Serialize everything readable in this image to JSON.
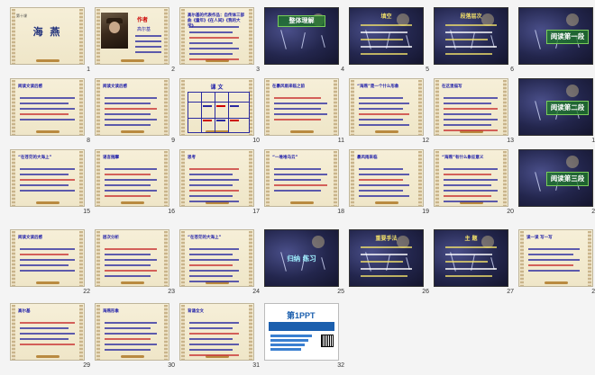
{
  "grid": {
    "rows": [
      [
        {
          "num": "1",
          "kind": "title",
          "label": "第十课",
          "title": "海 燕"
        },
        {
          "num": "2",
          "kind": "author",
          "label": "作者",
          "text": "高尔基"
        },
        {
          "num": "3",
          "kind": "text",
          "text": "高尔基的代表作品：自传体三部曲《童年》《在人间》《我的大学》"
        },
        {
          "num": "4",
          "kind": "dark",
          "title": "整体理解"
        },
        {
          "num": "5",
          "kind": "dark",
          "title": "填空"
        },
        {
          "num": "6",
          "kind": "dark",
          "title": "段落层次"
        },
        {
          "num": "7",
          "kind": "dark",
          "title": "阅读第一段"
        }
      ],
      [
        {
          "num": "8",
          "kind": "text",
          "text": "阅读文读后感"
        },
        {
          "num": "9",
          "kind": "text",
          "text": "阅读文读后感"
        },
        {
          "num": "10",
          "kind": "table",
          "text": "课 文"
        },
        {
          "num": "11",
          "kind": "text",
          "text": "在暴风雨来临之前"
        },
        {
          "num": "12",
          "kind": "text",
          "text": "“海燕”是一个什么形象"
        },
        {
          "num": "13",
          "kind": "text",
          "text": "在这里描写"
        },
        {
          "num": "14",
          "kind": "dark",
          "title": "阅读第二段"
        }
      ],
      [
        {
          "num": "15",
          "kind": "text",
          "text": "“在苍茫的大海上”"
        },
        {
          "num": "16",
          "kind": "text",
          "text": "语言揣摩"
        },
        {
          "num": "17",
          "kind": "text",
          "text": "思考"
        },
        {
          "num": "18",
          "kind": "text",
          "text": "“一堆堆乌云”"
        },
        {
          "num": "19",
          "kind": "text",
          "text": "暴风雨来临"
        },
        {
          "num": "20",
          "kind": "text",
          "text": "“海燕”有什么象征意义"
        },
        {
          "num": "21",
          "kind": "dark",
          "title": "阅读第三段"
        }
      ],
      [
        {
          "num": "22",
          "kind": "text",
          "text": "阅读文读后感"
        },
        {
          "num": "23",
          "kind": "text",
          "text": "层次分析"
        },
        {
          "num": "24",
          "kind": "text",
          "text": "“在苍茫的大海上”"
        },
        {
          "num": "25",
          "kind": "dark",
          "title": "归纳 练习"
        },
        {
          "num": "26",
          "kind": "dark",
          "title": "重要手法"
        },
        {
          "num": "27",
          "kind": "dark",
          "title": "主 题"
        },
        {
          "num": "28",
          "kind": "text",
          "text": "读一读 写一写"
        }
      ],
      [
        {
          "num": "29",
          "kind": "text",
          "text": "高尔基"
        },
        {
          "num": "30",
          "kind": "text",
          "text": "海燕形象"
        },
        {
          "num": "31",
          "kind": "text",
          "text": "背诵全文"
        },
        {
          "num": "32",
          "kind": "ppt",
          "title": "第1PPT"
        }
      ]
    ]
  }
}
